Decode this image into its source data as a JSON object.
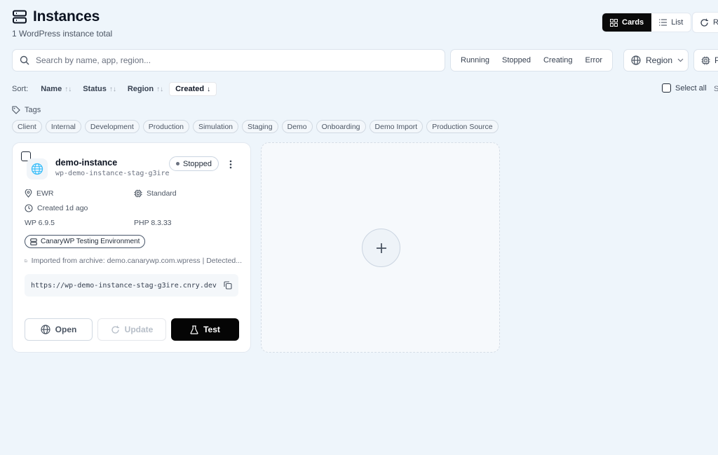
{
  "header": {
    "title": "Instances",
    "subtitle": "1 WordPress instance total",
    "view_cards": "Cards",
    "view_list": "List",
    "refresh_label": "R"
  },
  "search": {
    "placeholder": "Search by name, app, region..."
  },
  "status_filters": [
    "Running",
    "Stopped",
    "Creating",
    "Error"
  ],
  "region_filter": "Region",
  "plan_filter": "P",
  "sort": {
    "label": "Sort:",
    "options": [
      {
        "label": "Name",
        "arrow": "↑↓"
      },
      {
        "label": "Status",
        "arrow": "↑↓"
      },
      {
        "label": "Region",
        "arrow": "↑↓"
      },
      {
        "label": "Created",
        "arrow": "↓"
      }
    ],
    "active": "Created",
    "select_all": "Select all",
    "cut_text": "S"
  },
  "tags": {
    "label": "Tags",
    "items": [
      "Client",
      "Internal",
      "Development",
      "Production",
      "Simulation",
      "Staging",
      "Demo",
      "Onboarding",
      "Demo Import",
      "Production Source"
    ]
  },
  "instance": {
    "name": "demo-instance",
    "slug": "wp-demo-instance-stag-g3ire",
    "status": "Stopped",
    "region": "EWR",
    "plan": "Standard",
    "created": "Created 1d ago",
    "wp_version": "WP 6.9.5",
    "php_version": "PHP 8.3.33",
    "environment": "CanaryWP Testing Environment",
    "import_note": "Imported from archive: demo.canarywp.com.wpress | Detected...",
    "url": "https://wp-demo-instance-stag-g3ire.cnry.dev",
    "actions": {
      "open": "Open",
      "update": "Update",
      "test": "Test"
    }
  },
  "colors": {
    "accent_dark": "#0a0a0a",
    "background": "#eef5fb"
  }
}
